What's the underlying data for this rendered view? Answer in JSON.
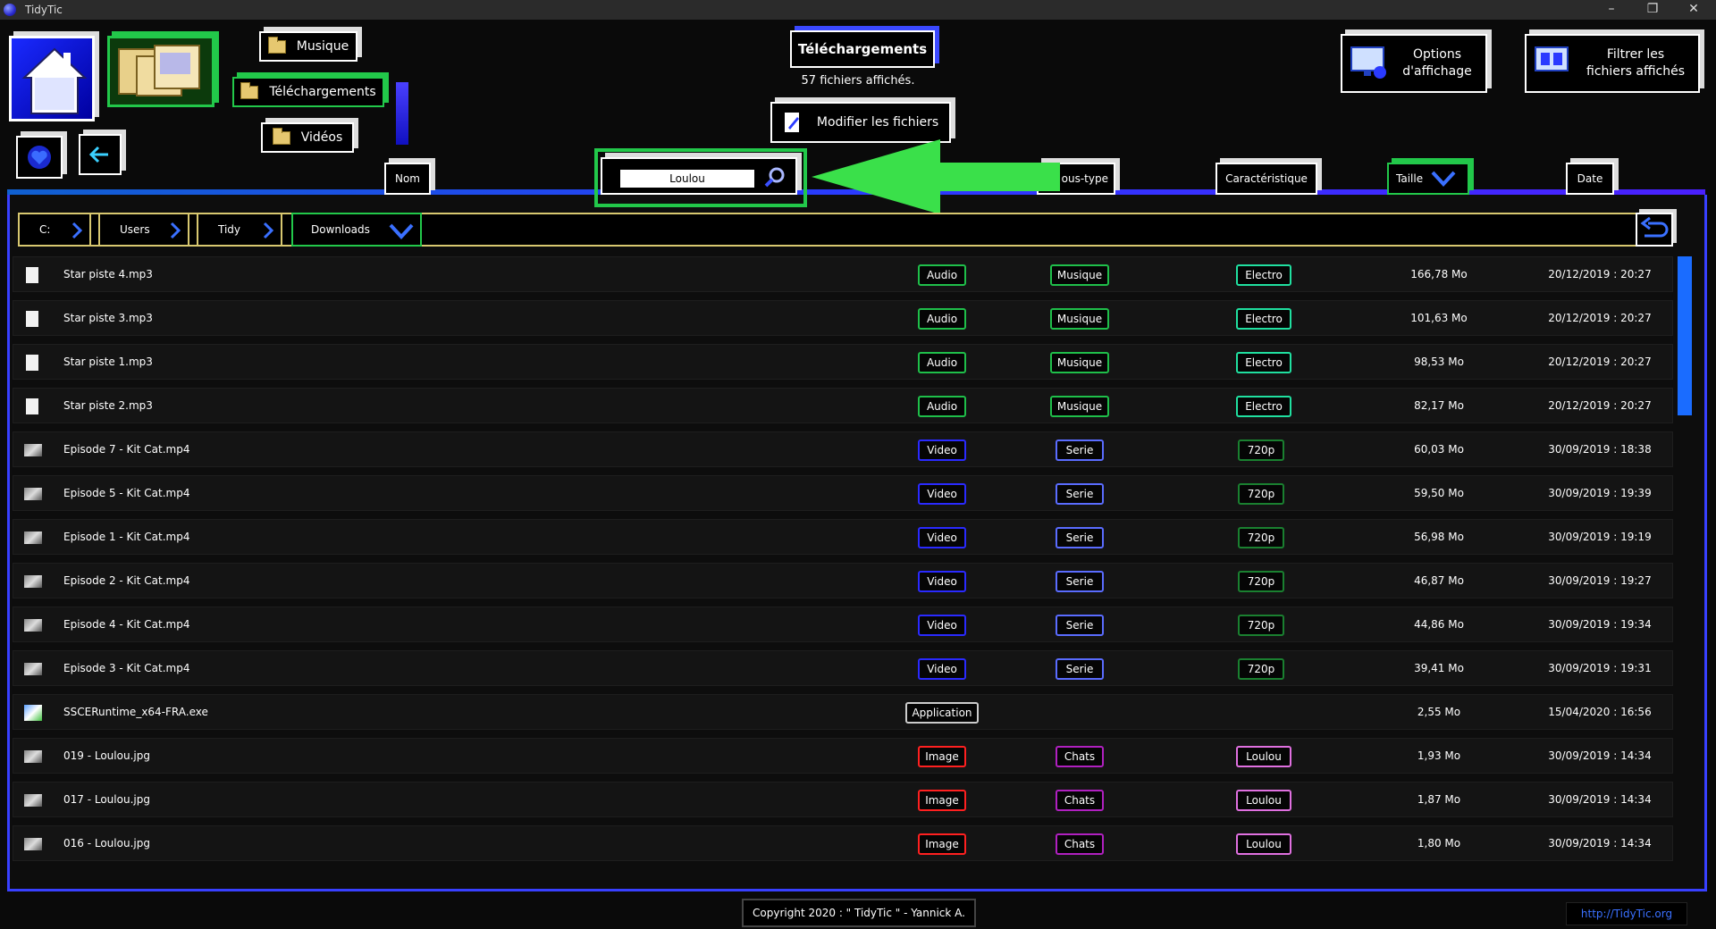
{
  "window": {
    "title": "TidyTic"
  },
  "nav": {
    "musique": "Musique",
    "telechargements": "Téléchargements",
    "videos": "Vidéos"
  },
  "header": {
    "current_folder": "Téléchargements",
    "files_count": "57 fichiers affichés.",
    "modify_button": "Modifier les fichiers",
    "options_line1": "Options",
    "options_line2": "d'affichage",
    "filter_line1": "Filtrer les",
    "filter_line2": "fichiers affichés"
  },
  "columns": {
    "nom": "Nom",
    "sous_type": "ous-type",
    "caracteristique": "Caractéristique",
    "taille": "Taille",
    "date": "Date"
  },
  "search": {
    "value": "Loulou"
  },
  "breadcrumb": [
    "C:",
    "Users",
    "Tidy",
    "Downloads"
  ],
  "colors": {
    "audio": "#1fbf4a",
    "video": "#2a2aff",
    "serie": "#5a6cff",
    "image": "#ff2020",
    "chats": "#b020c0",
    "loulou": "#e070e0",
    "electro": "#20e0a0",
    "application": "#cccccc"
  },
  "rows": [
    {
      "name": "Star piste 4.mp3",
      "type": "Audio",
      "subtype": "Musique",
      "feature": "Electro",
      "size": "166,78 Mo",
      "date": "20/12/2019 : 20:27",
      "icon": "audio-file-icon"
    },
    {
      "name": "Star piste 3.mp3",
      "type": "Audio",
      "subtype": "Musique",
      "feature": "Electro",
      "size": "101,63 Mo",
      "date": "20/12/2019 : 20:27",
      "icon": "audio-file-icon"
    },
    {
      "name": "Star piste 1.mp3",
      "type": "Audio",
      "subtype": "Musique",
      "feature": "Electro",
      "size": "98,53 Mo",
      "date": "20/12/2019 : 20:27",
      "icon": "audio-file-icon"
    },
    {
      "name": "Star piste 2.mp3",
      "type": "Audio",
      "subtype": "Musique",
      "feature": "Electro",
      "size": "82,17 Mo",
      "date": "20/12/2019 : 20:27",
      "icon": "audio-file-icon"
    },
    {
      "name": "Episode 7 - Kit Cat.mp4",
      "type": "Video",
      "subtype": "Serie",
      "feature": "720p",
      "size": "60,03 Mo",
      "date": "30/09/2019 : 18:38",
      "icon": "video-thumbnail-icon"
    },
    {
      "name": "Episode 5 - Kit Cat.mp4",
      "type": "Video",
      "subtype": "Serie",
      "feature": "720p",
      "size": "59,50 Mo",
      "date": "30/09/2019 : 19:39",
      "icon": "video-thumbnail-icon"
    },
    {
      "name": "Episode 1 - Kit Cat.mp4",
      "type": "Video",
      "subtype": "Serie",
      "feature": "720p",
      "size": "56,98 Mo",
      "date": "30/09/2019 : 19:19",
      "icon": "video-thumbnail-icon"
    },
    {
      "name": "Episode 2 - Kit Cat.mp4",
      "type": "Video",
      "subtype": "Serie",
      "feature": "720p",
      "size": "46,87 Mo",
      "date": "30/09/2019 : 19:27",
      "icon": "video-thumbnail-icon"
    },
    {
      "name": "Episode 4 - Kit Cat.mp4",
      "type": "Video",
      "subtype": "Serie",
      "feature": "720p",
      "size": "44,86 Mo",
      "date": "30/09/2019 : 19:34",
      "icon": "video-thumbnail-icon"
    },
    {
      "name": "Episode 3 - Kit Cat.mp4",
      "type": "Video",
      "subtype": "Serie",
      "feature": "720p",
      "size": "39,41 Mo",
      "date": "30/09/2019 : 19:31",
      "icon": "video-thumbnail-icon"
    },
    {
      "name": "SSCERuntime_x64-FRA.exe",
      "type": "Application",
      "subtype": "",
      "feature": "",
      "size": "2,55 Mo",
      "date": "15/04/2020 : 16:56",
      "icon": "installer-icon"
    },
    {
      "name": "019 - Loulou.jpg",
      "type": "Image",
      "subtype": "Chats",
      "feature": "Loulou",
      "size": "1,93 Mo",
      "date": "30/09/2019 : 14:34",
      "icon": "image-thumbnail-icon"
    },
    {
      "name": "017 - Loulou.jpg",
      "type": "Image",
      "subtype": "Chats",
      "feature": "Loulou",
      "size": "1,87 Mo",
      "date": "30/09/2019 : 14:34",
      "icon": "image-thumbnail-icon"
    },
    {
      "name": "016 - Loulou.jpg",
      "type": "Image",
      "subtype": "Chats",
      "feature": "Loulou",
      "size": "1,80 Mo",
      "date": "30/09/2019 : 14:34",
      "icon": "image-thumbnail-icon"
    }
  ],
  "footer": {
    "copyright": "Copyright 2020 : \" TidyTic \" - Yannick A.",
    "link": "http://TidyTic.org"
  }
}
